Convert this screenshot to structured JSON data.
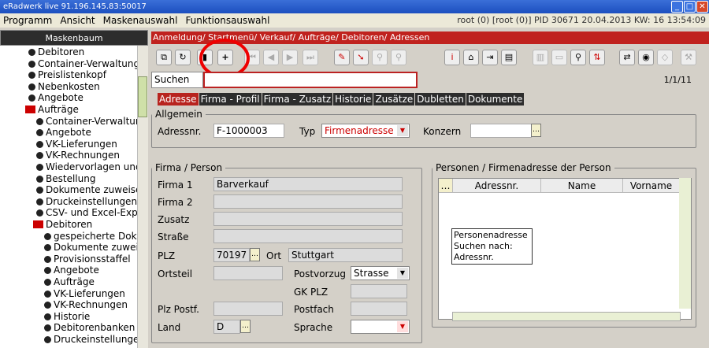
{
  "window": {
    "title": "eRadwerk live 91.196.145.83:50017",
    "status": "root (0) [root (0)] PID 30671  20.04.2013 KW: 16  13:54:09"
  },
  "menu": [
    "Programm",
    "Ansicht",
    "Maskenauswahl",
    "Funktionsauswahl"
  ],
  "sidebar": {
    "title": "Maskenbaum",
    "items": [
      {
        "label": "Debitoren",
        "kind": "dot",
        "level": 0
      },
      {
        "label": "Container-Verwaltung",
        "kind": "dot",
        "level": 0
      },
      {
        "label": "Preislistenkopf",
        "kind": "dot",
        "level": 0
      },
      {
        "label": "Nebenkosten",
        "kind": "dot",
        "level": 0
      },
      {
        "label": "Angebote",
        "kind": "dot",
        "level": 0
      },
      {
        "label": "Aufträge",
        "kind": "folder",
        "level": 0
      },
      {
        "label": "Container-Verwaltung",
        "kind": "dot",
        "level": 1
      },
      {
        "label": "Angebote",
        "kind": "dot",
        "level": 1
      },
      {
        "label": "VK-Lieferungen",
        "kind": "dot",
        "level": 1
      },
      {
        "label": "VK-Rechnungen",
        "kind": "dot",
        "level": 1
      },
      {
        "label": "Wiedervorlagen und",
        "kind": "dot",
        "level": 1
      },
      {
        "label": "Bestellung",
        "kind": "dot",
        "level": 1
      },
      {
        "label": "Dokumente zuweise",
        "kind": "dot",
        "level": 1
      },
      {
        "label": "Druckeinstellungen",
        "kind": "dot",
        "level": 1
      },
      {
        "label": "CSV- und Excel-Exp",
        "kind": "dot",
        "level": 1
      },
      {
        "label": "Debitoren",
        "kind": "folder",
        "level": 1
      },
      {
        "label": "gespeicherte Doku",
        "kind": "dot",
        "level": 2
      },
      {
        "label": "Dokumente zuwei",
        "kind": "dot",
        "level": 2
      },
      {
        "label": "Provisionsstaffel",
        "kind": "dot",
        "level": 2
      },
      {
        "label": "Angebote",
        "kind": "dot",
        "level": 2
      },
      {
        "label": "Aufträge",
        "kind": "dot",
        "level": 2
      },
      {
        "label": "VK-Lieferungen",
        "kind": "dot",
        "level": 2
      },
      {
        "label": "VK-Rechnungen",
        "kind": "dot",
        "level": 2
      },
      {
        "label": "Historie",
        "kind": "dot",
        "level": 2
      },
      {
        "label": "Debitorenbanken",
        "kind": "dot",
        "level": 2
      },
      {
        "label": "Druckeinstellunge",
        "kind": "dot",
        "level": 2
      }
    ]
  },
  "breadcrumb": "Anmeldung/ Startmenü/ Verkauf/ Aufträge/ Debitoren/ Adressen",
  "search": {
    "label": "Suchen",
    "value": "",
    "pager": "1/1/11"
  },
  "tabs": [
    "Adresse",
    "Firma - Profil",
    "Firma - Zusatz",
    "Historie",
    "Zusätze",
    "Dubletten",
    "Dokumente"
  ],
  "allgemein": {
    "legend": "Allgemein",
    "adressnr_label": "Adressnr.",
    "adressnr": "F-1000003",
    "typ_label": "Typ",
    "typ": "Firmenadresse",
    "konzern_label": "Konzern",
    "konzern": ""
  },
  "firma": {
    "legend": "Firma / Person",
    "firma1_label": "Firma 1",
    "firma1": "Barverkauf",
    "firma2_label": "Firma 2",
    "firma2": "",
    "zusatz_label": "Zusatz",
    "zusatz": "",
    "strasse_label": "Straße",
    "strasse": "",
    "plz_label": "PLZ",
    "plz": "70197",
    "ort_label": "Ort",
    "ort": "Stuttgart",
    "ortsteil_label": "Ortsteil",
    "ortsteil": "",
    "postvorzug_label": "Postvorzug",
    "postvorzug": "Strasse",
    "gkplz_label": "GK PLZ",
    "gkplz": "",
    "plzpostf_label": "Plz Postf.",
    "plzpostf": "",
    "postfach_label": "Postfach",
    "postfach": "",
    "land_label": "Land",
    "land": "D",
    "sprache_label": "Sprache",
    "sprache": ""
  },
  "personen": {
    "legend": "Personen / Firmenadresse der Person",
    "columns": [
      "Adressnr.",
      "Name",
      "Vorname"
    ],
    "tooltip": [
      "Personenadresse",
      "Suchen nach:",
      "Adressnr."
    ]
  }
}
